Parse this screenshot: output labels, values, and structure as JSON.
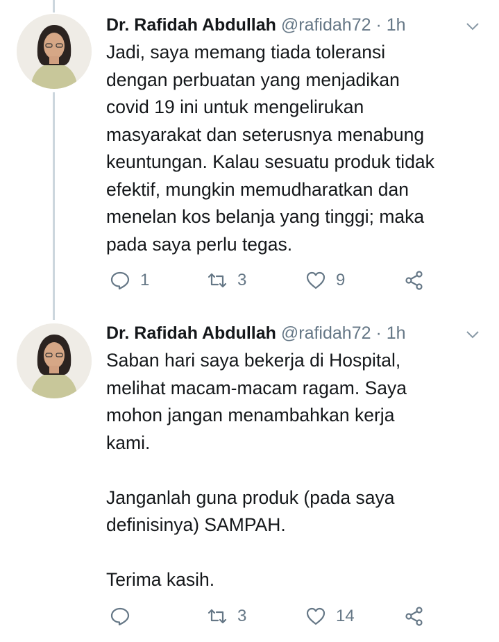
{
  "tweets": [
    {
      "author_name": "Dr. Rafidah Abdullah",
      "handle": "@rafidah72",
      "separator": "·",
      "time": "1h",
      "body_lines": [
        "Jadi, saya memang tiada toleransi",
        "dengan perbuatan yang menjadikan",
        "covid 19 ini untuk mengelirukan",
        "masyarakat dan seterusnya menabung",
        "keuntungan. Kalau sesuatu produk tidak",
        "efektif, mungkin memudharatkan dan",
        "menelan kos belanja yang tinggi; maka",
        "pada saya perlu tegas."
      ],
      "replies": "1",
      "retweets": "3",
      "likes": "9"
    },
    {
      "author_name": "Dr. Rafidah Abdullah",
      "handle": "@rafidah72",
      "separator": "·",
      "time": "1h",
      "body_lines": [
        "Saban hari saya bekerja di Hospital,",
        "melihat macam-macam ragam. Saya",
        "mohon jangan menambahkan kerja",
        "kami.",
        "",
        "Janganlah guna produk (pada saya",
        "definisinya) SAMPAH.",
        "",
        "Terima kasih."
      ],
      "replies": "",
      "retweets": "3",
      "likes": "14"
    }
  ],
  "icons": {
    "reply": "reply-icon",
    "retweet": "retweet-icon",
    "like": "heart-icon",
    "share": "share-icon",
    "caret": "chevron-down-icon"
  },
  "colors": {
    "text": "#14171a",
    "secondary": "#657786",
    "thread_line": "#ccd6dd"
  }
}
